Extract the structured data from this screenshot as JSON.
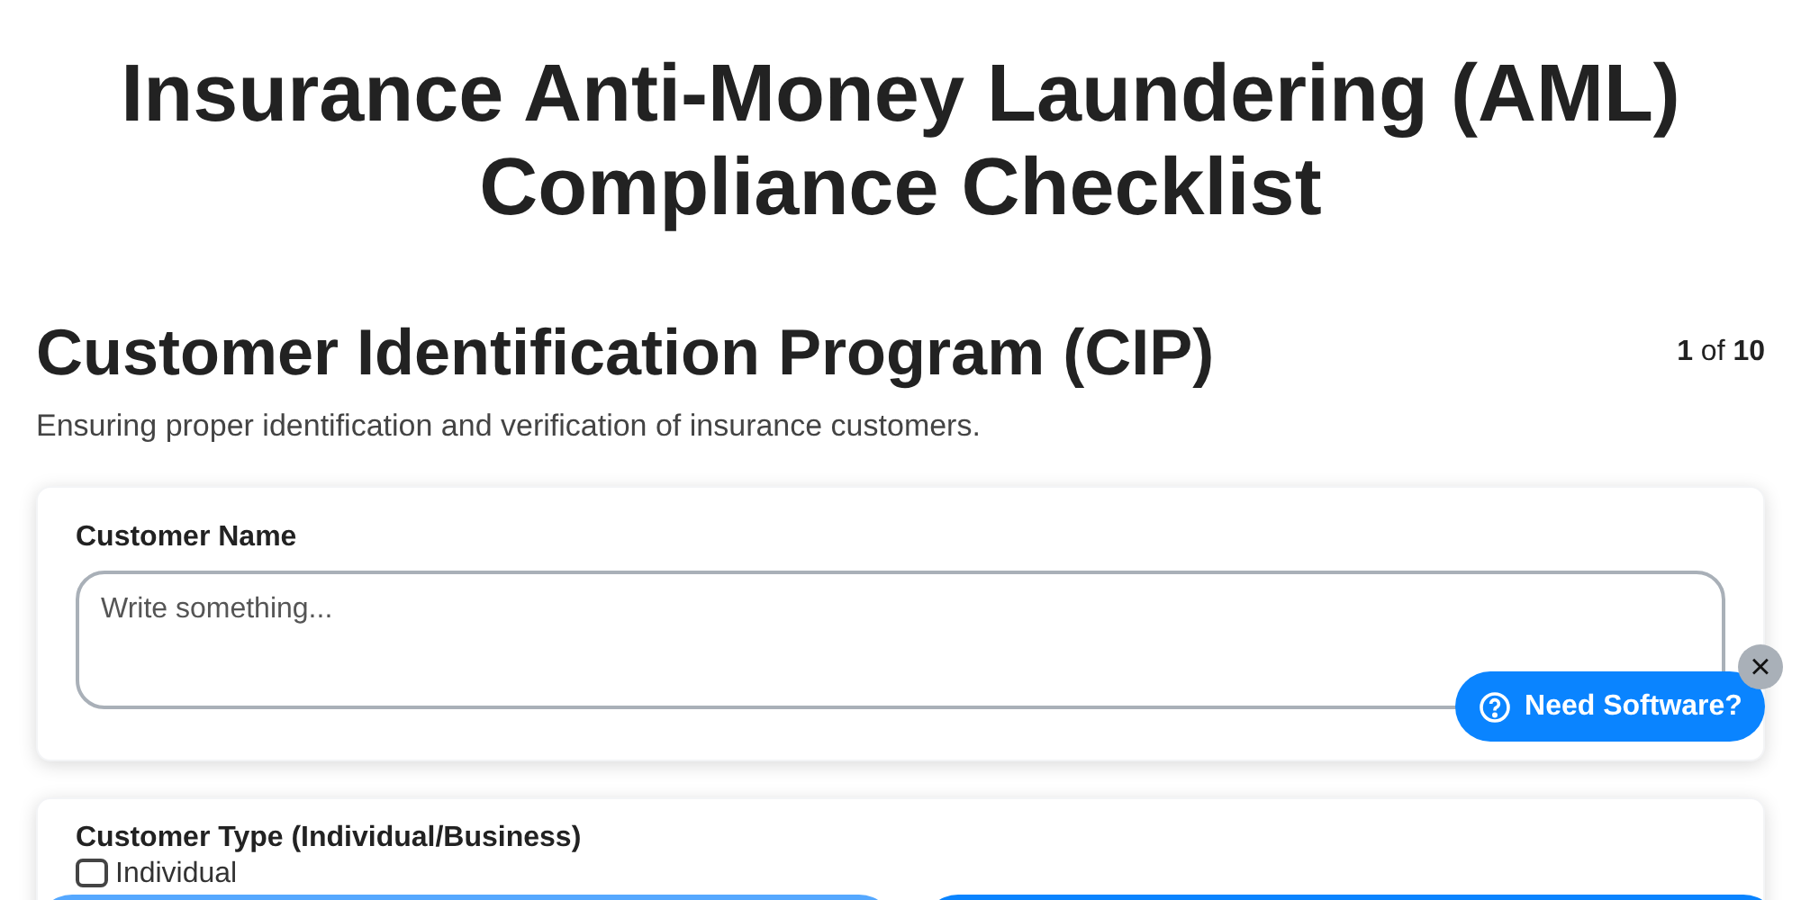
{
  "title": "Insurance Anti-Money Laundering (AML) Compliance Checklist",
  "section": {
    "title": "Customer Identification Program (CIP)",
    "counter": "**1** of **10**",
    "description": "Ensuring proper identification and verification of insurance customers."
  },
  "questions": [
    {
      "kind": "text",
      "label": "Customer Name",
      "placeholder": "Write something..."
    },
    {
      "kind": "checkbox",
      "label": "Customer Type (Individual/Business)",
      "options": [
        {
          "label": "Individual",
          "checked": false
        }
      ]
    }
  ],
  "popup": {
    "label": "Need Software?",
    "close": "×"
  },
  "bottom_buttons": [
    {
      "kind": "secondary"
    },
    {
      "kind": "primary"
    }
  ]
}
